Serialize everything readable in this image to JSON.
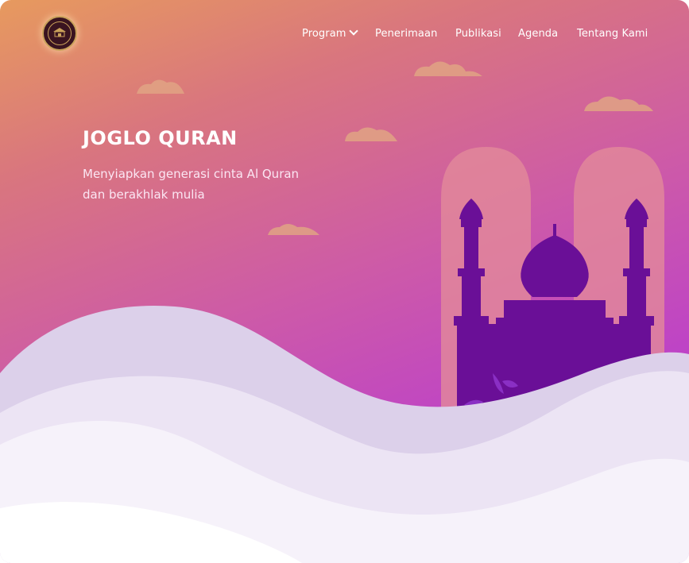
{
  "header": {
    "logo_name": "joglo-quran-logo",
    "nav": [
      {
        "label": "Program",
        "has_dropdown": true
      },
      {
        "label": "Penerimaan",
        "has_dropdown": false
      },
      {
        "label": "Publikasi",
        "has_dropdown": false
      },
      {
        "label": "Agenda",
        "has_dropdown": false
      },
      {
        "label": "Tentang Kami",
        "has_dropdown": false
      }
    ]
  },
  "hero": {
    "title": "JOGLO QURAN",
    "subtitle_line1": "Menyiapkan generasi cinta Al Quran",
    "subtitle_line2": "dan berakhlak mulia"
  },
  "colors": {
    "gradient_start": "#e79a5e",
    "gradient_end": "#b133df",
    "mosque": "#6a0f97",
    "cloud": "#e0a384",
    "arch": "#e28a9a",
    "dune": "#f3eef8"
  },
  "icons": [
    "chevron-down-icon",
    "crescent-icon",
    "cloud-icon",
    "leaf-icon"
  ]
}
